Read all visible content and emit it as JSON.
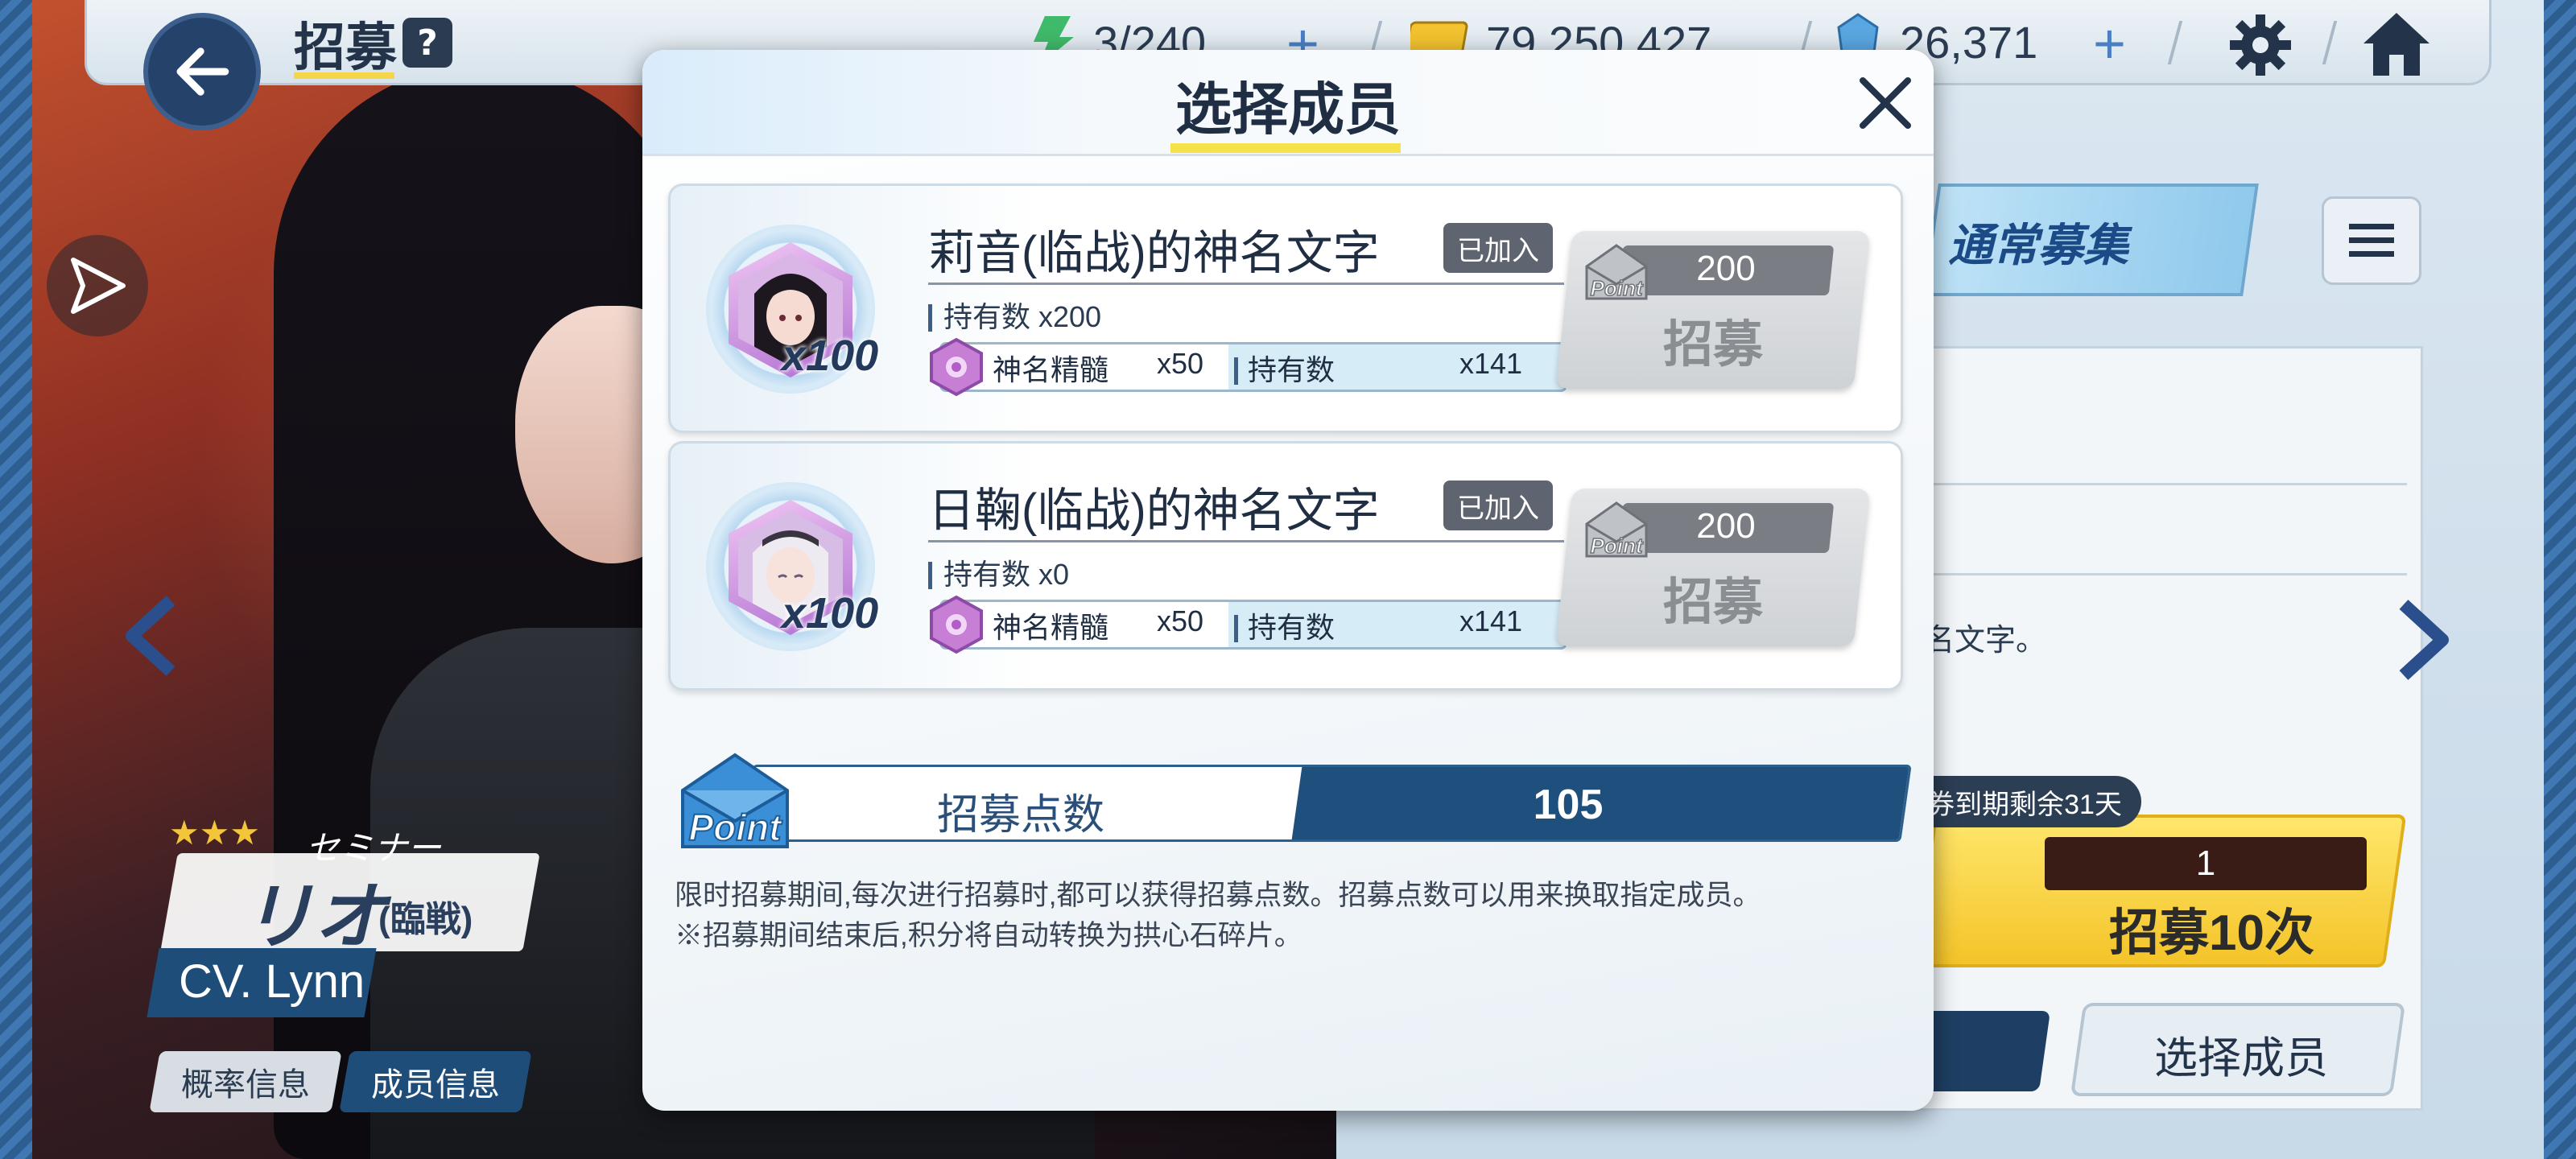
{
  "header": {
    "page_title": "招募",
    "help_label": "?",
    "resources": [
      {
        "icon": "energy-icon",
        "value": "3/240"
      },
      {
        "icon": "credit-icon",
        "value": "79,250,427"
      },
      {
        "icon": "pyroxene-icon",
        "value": "26,371"
      }
    ]
  },
  "character": {
    "rarity": "★★★",
    "school": "セミナー",
    "name": "リオ",
    "name_suffix": "(臨戦)",
    "cv": "CV. Lynn",
    "buttons": [
      "概率信息",
      "成员信息"
    ]
  },
  "side": {
    "banner_label": "通常募集",
    "info_text": "名文字。",
    "expire_tag": "券到期剩余31天",
    "ticket_count": "1",
    "recruit10_label": "招募10次",
    "select_member_label": "选择成员"
  },
  "modal": {
    "title": "选择成员",
    "cards": [
      {
        "name": "莉音(临战)的神名文字",
        "joined_tag": "已加入",
        "avatar_qty": "x100",
        "owned": "持有数 x200",
        "essence_name": "神名精髓",
        "essence_cost": "x50",
        "essence_owned_label": "持有数",
        "essence_owned": "x141",
        "recruit_cost": "200",
        "recruit_label": "招募",
        "point_icon_text": "Point"
      },
      {
        "name": "日鞠(临战)的神名文字",
        "joined_tag": "已加入",
        "avatar_qty": "x100",
        "owned": "持有数 x0",
        "essence_name": "神名精髓",
        "essence_cost": "x50",
        "essence_owned_label": "持有数",
        "essence_owned": "x141",
        "recruit_cost": "200",
        "recruit_label": "招募",
        "point_icon_text": "Point"
      }
    ],
    "points": {
      "icon_text": "Point",
      "label": "招募点数",
      "value": "105"
    },
    "description": [
      "限时招募期间,每次进行招募时,都可以获得招募点数。招募点数可以用来换取指定成员。",
      "※招募期间结束后,积分将自动转换为拱心石碎片。"
    ]
  },
  "colors": {
    "accent_navy": "#1f4f7d",
    "title_underline": "#f5e24a",
    "joined_tag": "#5f6570",
    "disabled_button": "#cfd2d5"
  }
}
